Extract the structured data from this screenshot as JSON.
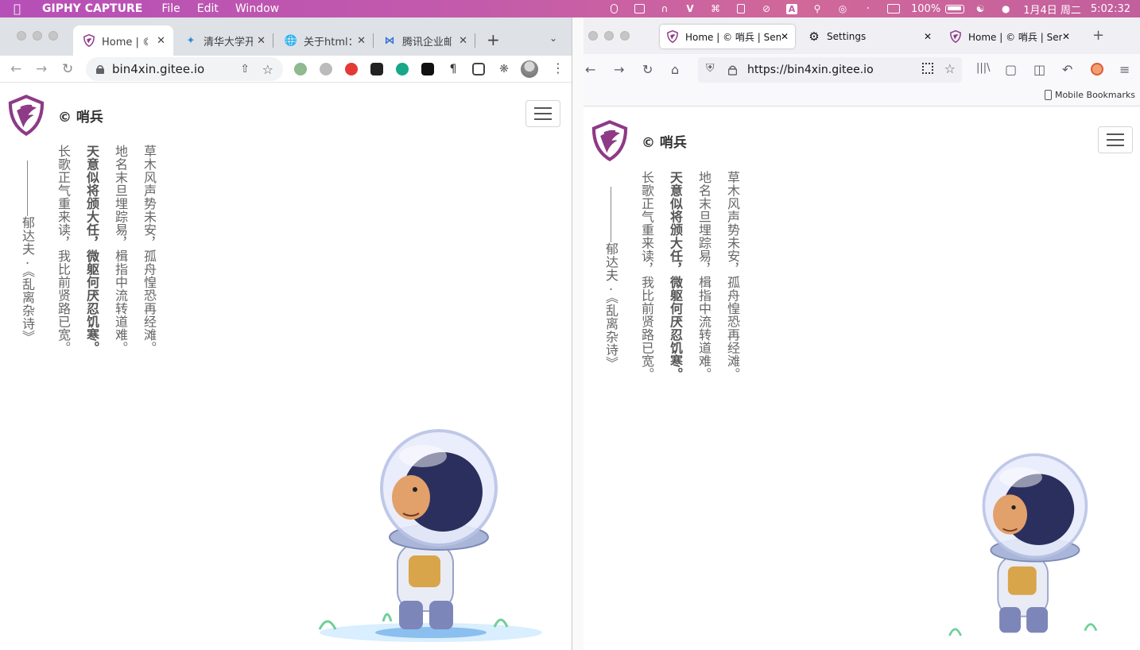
{
  "menubar": {
    "app": "GIPHY CAPTURE",
    "items": [
      "File",
      "Edit",
      "Window"
    ],
    "battery": "100%",
    "date": "1月4日 周二",
    "time": "5:02:32",
    "input_indicator": "A"
  },
  "chrome": {
    "tabs": [
      {
        "title": "Home | © 哨",
        "icon": "shield-logo-icon",
        "active": true
      },
      {
        "title": "清华大学开",
        "icon": "tsinghua-icon"
      },
      {
        "title": "关于html：",
        "icon": "globe-icon"
      },
      {
        "title": "腾讯企业邮",
        "icon": "tencent-mail-icon"
      }
    ],
    "url": "bin4xin.gitee.io"
  },
  "firefox": {
    "tabs": [
      {
        "title": "Home | © 哨兵 | Sentry",
        "active": true
      },
      {
        "title": "Settings"
      },
      {
        "title": "Home | © 哨兵 | Sentry"
      }
    ],
    "url": "https://bin4xin.gitee.io",
    "bookmarks_label": "Mobile Bookmarks"
  },
  "site": {
    "brand": "© 哨兵",
    "poem": {
      "lines": [
        "草木风声势未安，孤舟惶恐再经滩。",
        "地名末旦埋踪易，楫指中流转道难。",
        "天意似将颁大任，微躯何厌忍饥寒。",
        "长歌正气重来读，我比前贤路已宽。"
      ],
      "author": "郁达夫·《乱离杂诗》"
    }
  },
  "colors": {
    "brand_purple": "#8e3a87",
    "menubar": "#c35aab"
  }
}
